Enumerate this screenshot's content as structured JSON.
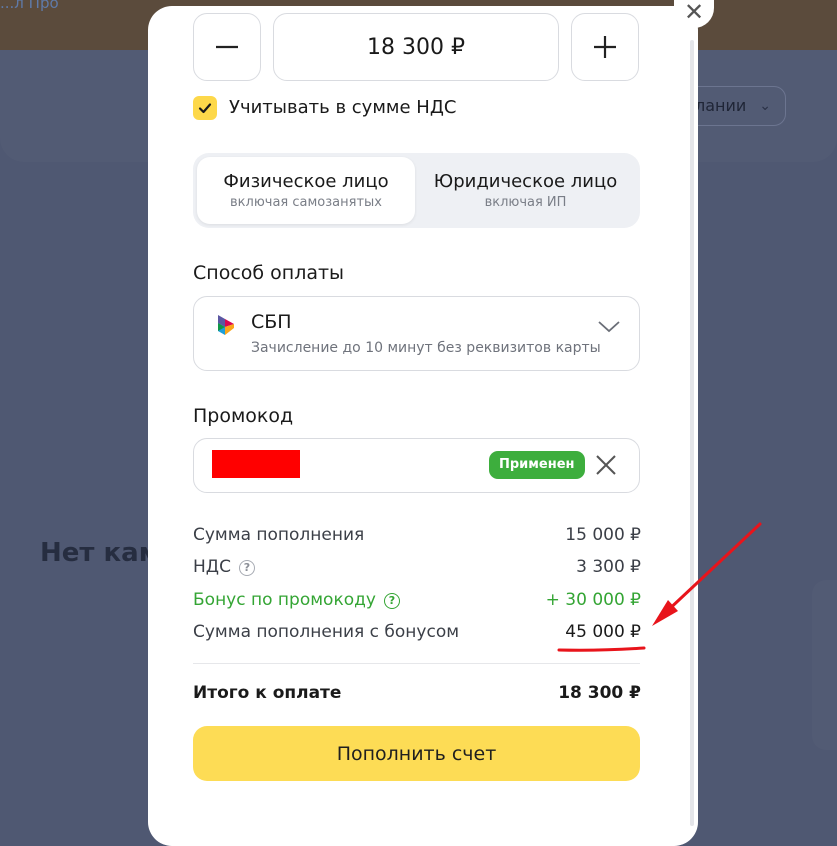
{
  "background": {
    "top_link": "...л Про",
    "filter_pill_label": "лании",
    "heading": "Нет кам"
  },
  "modal": {
    "amount": {
      "minus_symbol": "−",
      "value": "18 300 ₽",
      "plus_symbol": "+"
    },
    "vat_checkbox": {
      "checked": true,
      "label": "Учитывать в сумме НДС"
    },
    "payer_type": {
      "options": [
        {
          "title": "Физическое лицо",
          "subtitle": "включая самозанятых",
          "selected": true
        },
        {
          "title": "Юридическое лицо",
          "subtitle": "включая ИП",
          "selected": false
        }
      ]
    },
    "payment_method": {
      "label": "Способ оплаты",
      "selected_title": "СБП",
      "selected_subtitle": "Зачисление до 10 минут без реквизитов карты"
    },
    "promo": {
      "label": "Промокод",
      "value": "",
      "status_badge": "Применен"
    },
    "summary": {
      "rows": [
        {
          "label": "Сумма пополнения",
          "value": "15 000 ₽"
        },
        {
          "label": "НДС",
          "value": "3 300 ₽"
        },
        {
          "label": "Бонус по промокоду",
          "value": "+ 30 000 ₽"
        },
        {
          "label": "Сумма пополнения с бонусом",
          "value": "45 000 ₽"
        }
      ],
      "total_label": "Итого к оплате",
      "total_value": "18 300 ₽"
    },
    "submit_label": "Пополнить счет"
  },
  "colors": {
    "accent_yellow": "#fddc55",
    "success_green": "#3dae3d",
    "annotation_red": "#e8141b"
  }
}
